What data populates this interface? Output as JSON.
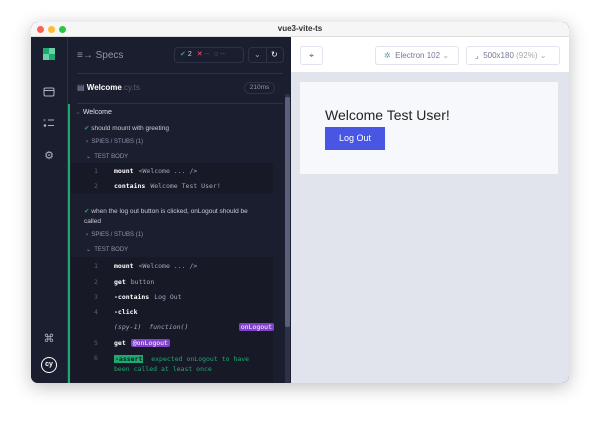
{
  "window": {
    "title": "vue3-vite-ts",
    "traffic_colors": [
      "#ff5f57",
      "#febc2e",
      "#28c840"
    ]
  },
  "nav": {
    "icons": [
      "cypress-logo-icon",
      "specs-icon",
      "runs-icon",
      "settings-icon",
      "keyboard-shortcuts-icon",
      "cy-logo-icon"
    ]
  },
  "reporter": {
    "header": {
      "label": "Specs",
      "passed": "2",
      "failed": "--",
      "pending": "--"
    },
    "spec": {
      "name": "Welcome",
      "ext": ".cy.ts",
      "duration": "210ms"
    },
    "suite": "Welcome",
    "tests": [
      {
        "title": "should mount with greeting",
        "spies": "SPIES / STUBS (1)",
        "body": "TEST BODY",
        "commands": [
          {
            "n": "1",
            "name": "mount",
            "msg": "<Welcome ... />"
          },
          {
            "n": "2",
            "name": "contains",
            "msg": "Welcome Test User!"
          }
        ]
      },
      {
        "title": "when the log out button is clicked, onLogout should be called",
        "spies": "SPIES / STUBS (1)",
        "body": "TEST BODY",
        "commands": [
          {
            "n": "1",
            "name": "mount",
            "msg": "<Welcome ... />"
          },
          {
            "n": "2",
            "name": "get",
            "msg": "button"
          },
          {
            "n": "3",
            "name": "-contains",
            "msg": "Log Out"
          },
          {
            "n": "4",
            "name": "-click",
            "msg": ""
          },
          {
            "n": "",
            "name": "(spy-1)",
            "msg": "function()",
            "alias": "onLogout"
          },
          {
            "n": "5",
            "name": "get",
            "alias": "@onLogout"
          },
          {
            "n": "6",
            "name": "-assert",
            "msg": "expected onLogout to have been called at least once"
          }
        ]
      }
    ]
  },
  "toolbar": {
    "browser": "Electron 102",
    "viewport": "500x180",
    "zoom": "(92%)"
  },
  "app": {
    "heading": "Welcome Test User!",
    "button": "Log Out",
    "accent": "#4956e3"
  }
}
